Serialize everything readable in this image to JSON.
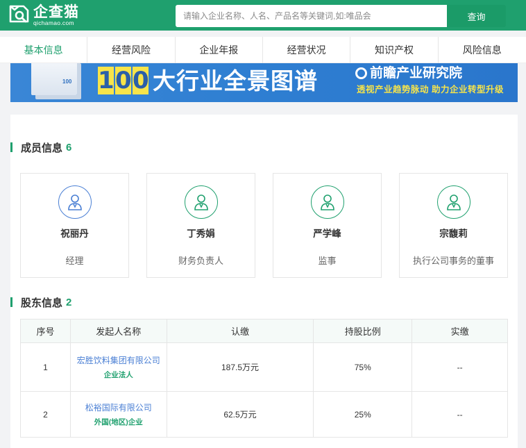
{
  "header": {
    "logo_cn": "企查猫",
    "logo_en": "qichamao.com",
    "search_placeholder": "请输入企业名称、人名、产品名等关键词,如:唯品会",
    "search_button": "查询"
  },
  "tabs": [
    {
      "label": "基本信息",
      "active": true
    },
    {
      "label": "经营风险",
      "active": false
    },
    {
      "label": "企业年报",
      "active": false
    },
    {
      "label": "经营状况",
      "active": false
    },
    {
      "label": "知识产权",
      "active": false
    },
    {
      "label": "风险信息",
      "active": false
    }
  ],
  "banner": {
    "number": "100",
    "title": "大行业全景图谱",
    "brand": "前瞻产业研究院",
    "slogan": "透视产业趋势脉动 助力企业转型升级"
  },
  "members_section": {
    "title": "成员信息",
    "count": "6",
    "members": [
      {
        "name": "祝丽丹",
        "role": "经理",
        "avatar_color": "#4a7fd4"
      },
      {
        "name": "丁秀娟",
        "role": "财务负责人",
        "avatar_color": "#1fa06e"
      },
      {
        "name": "严学峰",
        "role": "监事",
        "avatar_color": "#1fa06e"
      },
      {
        "name": "宗馥莉",
        "role": "执行公司事务的董事",
        "avatar_color": "#1fa06e"
      }
    ]
  },
  "shareholders_section": {
    "title": "股东信息",
    "count": "2",
    "columns": [
      "序号",
      "发起人名称",
      "认缴",
      "持股比例",
      "实缴"
    ],
    "rows": [
      {
        "index": "1",
        "name": "宏胜饮料集团有限公司",
        "tag": "企业法人",
        "subscribed": "187.5万元",
        "ratio": "75%",
        "paid": "--"
      },
      {
        "index": "2",
        "name": "松裕国际有限公司",
        "tag": "外国(地区)企业",
        "subscribed": "62.5万元",
        "ratio": "25%",
        "paid": "--"
      }
    ]
  },
  "colors": {
    "brand_green": "#1fa06e",
    "link_blue": "#4a7fd4"
  }
}
